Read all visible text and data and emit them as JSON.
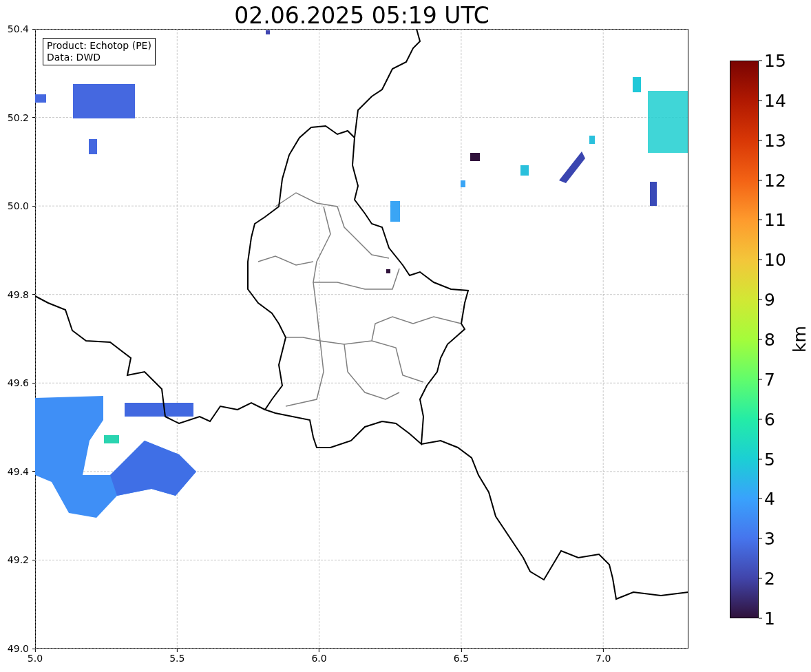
{
  "title": "02.06.2025 05:19 UTC",
  "legend": [
    "Product: Echotop (PE)",
    "Data: DWD"
  ],
  "map": {
    "xticks": [
      "5.0",
      "5.5",
      "6.0",
      "6.5",
      "7.0"
    ],
    "yticks": [
      "50.4",
      "50.2",
      "50.0",
      "49.8",
      "49.6",
      "49.4",
      "49.2",
      "49.0"
    ]
  },
  "colorbar": {
    "label": "km",
    "ticks": [
      "15",
      "14",
      "13",
      "12",
      "11",
      "10",
      "9",
      "8",
      "7",
      "6",
      "5",
      "4",
      "3",
      "2",
      "1"
    ]
  }
}
